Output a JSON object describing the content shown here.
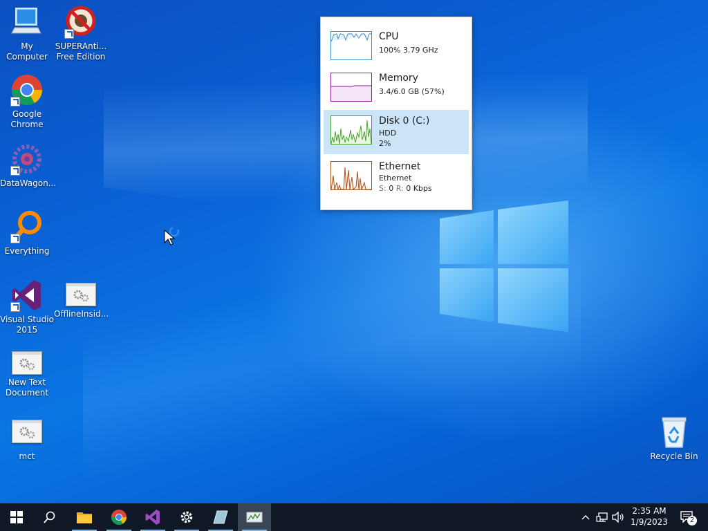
{
  "desktop": {
    "icons": [
      {
        "label": "My Computer",
        "icon": "computer-icon"
      },
      {
        "label": "SUPERAnti... Free Edition",
        "icon": "superantispyware-icon"
      },
      {
        "label": "Google Chrome",
        "icon": "chrome-icon"
      },
      {
        "label": "DataWagon...",
        "icon": "datawagon-icon"
      },
      {
        "label": "Everything",
        "icon": "everything-search-icon"
      },
      {
        "label": "Visual Studio 2015",
        "icon": "visual-studio-icon"
      },
      {
        "label": "OfflineInsid...",
        "icon": "gear-window-icon"
      },
      {
        "label": "New Text Document",
        "icon": "gear-window-icon"
      },
      {
        "label": "mct",
        "icon": "gear-window-icon"
      },
      {
        "label": "Recycle Bin",
        "icon": "recycle-bin-icon"
      }
    ]
  },
  "performance": {
    "rows": [
      {
        "title": "CPU",
        "line1": "100% 3.79 GHz",
        "color": "#3c8cc8"
      },
      {
        "title": "Memory",
        "line1": "3.4/6.0 GB (57%)",
        "color": "#8b1a9e"
      },
      {
        "title": "Disk 0 (C:)",
        "line1": "HDD",
        "line2": "2%",
        "color": "#4aa02c",
        "selected": true
      },
      {
        "title": "Ethernet",
        "line1": "Ethernet",
        "send_label": "S:",
        "send_value": "0",
        "recv_label": "R:",
        "recv_value": "0 Kbps",
        "color": "#a7511a"
      }
    ]
  },
  "taskbar": {
    "items": [
      {
        "name": "start-button",
        "icon": "windows-icon"
      },
      {
        "name": "search-button",
        "icon": "search-icon"
      },
      {
        "name": "file-explorer",
        "icon": "folder-icon"
      },
      {
        "name": "google-chrome",
        "icon": "chrome-icon"
      },
      {
        "name": "visual-studio",
        "icon": "visual-studio-icon"
      },
      {
        "name": "settings",
        "icon": "gear-icon"
      },
      {
        "name": "app-window",
        "icon": "glass-window-icon"
      },
      {
        "name": "task-manager",
        "icon": "task-manager-icon",
        "active": true
      }
    ],
    "clock": {
      "time": "2:35 AM",
      "date": "1/9/2023"
    },
    "notifications_count": "2"
  }
}
